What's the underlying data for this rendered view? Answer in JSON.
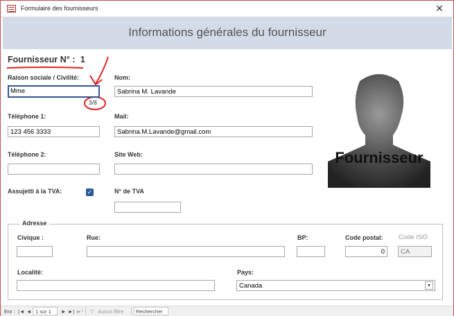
{
  "window": {
    "title": "Formulaire des fournisseurs",
    "close_glyph": "✕"
  },
  "header": {
    "title": "Informations générales du fournisseur"
  },
  "supplier": {
    "number_label": "Fournisseur N° :",
    "number_value": "1"
  },
  "fields": {
    "raison_sociale": {
      "label": "Raison sociale / Civilité:",
      "value": "Mme",
      "counter": "3/8"
    },
    "nom": {
      "label": "Nom:",
      "value": "Sabrina M. Lavande"
    },
    "telephone1": {
      "label": "Téléphone 1:",
      "value": "123 456 3333"
    },
    "mail": {
      "label": "Mail:",
      "value": "Sabrina.M.Lavande@gmail.com"
    },
    "telephone2": {
      "label": "Téléphone 2:",
      "value": ""
    },
    "site_web": {
      "label": "Site Web:",
      "value": ""
    },
    "tva": {
      "label": "Assujetti à la TVA:",
      "checked": true
    },
    "num_tva": {
      "label": "N° de TVA",
      "value": ""
    }
  },
  "photo": {
    "caption": "Fournisseur"
  },
  "address": {
    "legend": "Adresse",
    "civique": {
      "label": "Civique :",
      "value": ""
    },
    "rue": {
      "label": "Rue:",
      "value": ""
    },
    "bp": {
      "label": "BP:",
      "value": ""
    },
    "code_postal": {
      "label": "Code postal:",
      "value": "0"
    },
    "code_iso": {
      "label": "Code ISO",
      "value": "CA"
    },
    "localite": {
      "label": "Localité:",
      "value": ""
    },
    "pays": {
      "label": "Pays:",
      "value": "Canada"
    }
  },
  "statusbar": {
    "record_label": "Enr :",
    "first": "|◄",
    "prev": "◄",
    "position": "1 sur 1",
    "next": "►",
    "last": "►|",
    "new": "►*",
    "filter_label": "Aucun filtre",
    "search_label": "Rechercher"
  },
  "colors": {
    "header_bg": "#d3dbe8",
    "focus_border": "#2f5597",
    "annotation_red": "#e02020",
    "checkbox": "#2b579a"
  }
}
